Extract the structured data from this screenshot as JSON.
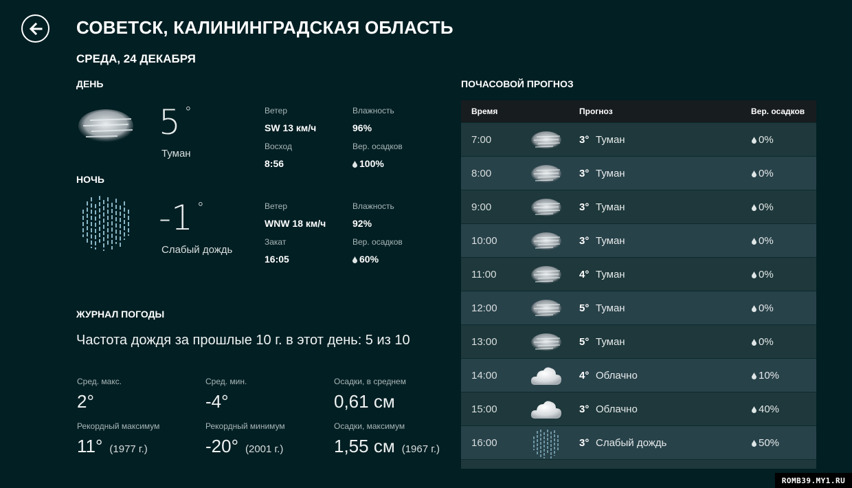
{
  "header": {
    "city": "СОВЕТСК, КАЛИНИНГРАДСКАЯ ОБЛАСТЬ",
    "date": "СРЕДА, 24 ДЕКАБРЯ",
    "back_icon": "back-arrow-icon"
  },
  "day": {
    "label": "ДЕНЬ",
    "icon": "fog-icon",
    "temp": "5",
    "deg": "°",
    "condition": "Туман",
    "wind_label": "Ветер",
    "wind": "SW 13 км/ч",
    "humidity_label": "Влажность",
    "humidity": "96%",
    "sun_label": "Восход",
    "sun": "8:56",
    "precip_label": "Вер. осадков",
    "precip": "100%"
  },
  "night": {
    "label": "НОЧЬ",
    "icon": "light-rain-icon",
    "temp": "-1",
    "deg": "°",
    "condition": "Слабый дождь",
    "wind_label": "Ветер",
    "wind": "WNW 18 км/ч",
    "humidity_label": "Влажность",
    "humidity": "92%",
    "sun_label": "Закат",
    "sun": "16:05",
    "precip_label": "Вер. осадков",
    "precip": "60%"
  },
  "history": {
    "label": "ЖУРНАЛ ПОГОДЫ",
    "title": "Частота дождя за прошлые 10 г. в этот день: 5 из 10",
    "avg_max_label": "Сред. макс.",
    "avg_max": "2°",
    "avg_min_label": "Сред. мин.",
    "avg_min": "-4°",
    "avg_precip_label": "Осадки, в среднем",
    "avg_precip": "0,61 см",
    "rec_max_label": "Рекордный максимум",
    "rec_max": "11°",
    "rec_max_year": "(1977 г.)",
    "rec_min_label": "Рекордный минимум",
    "rec_min": "-20°",
    "rec_min_year": "(2001 г.)",
    "max_precip_label": "Осадки, максимум",
    "max_precip": "1,55 см",
    "max_precip_year": "(1967 г.)"
  },
  "hourly": {
    "label": "ПОЧАСОВОЙ ПРОГНОЗ",
    "col_time": "Время",
    "col_forecast": "Прогноз",
    "col_precip": "Вер. осадков",
    "rows": [
      {
        "time": "7:00",
        "icon": "fog-icon",
        "temp": "3°",
        "cond": "Туман",
        "precip": "0%"
      },
      {
        "time": "8:00",
        "icon": "fog-icon",
        "temp": "3°",
        "cond": "Туман",
        "precip": "0%"
      },
      {
        "time": "9:00",
        "icon": "fog-icon",
        "temp": "3°",
        "cond": "Туман",
        "precip": "0%"
      },
      {
        "time": "10:00",
        "icon": "fog-icon",
        "temp": "3°",
        "cond": "Туман",
        "precip": "0%"
      },
      {
        "time": "11:00",
        "icon": "fog-icon",
        "temp": "4°",
        "cond": "Туман",
        "precip": "0%"
      },
      {
        "time": "12:00",
        "icon": "fog-icon",
        "temp": "5°",
        "cond": "Туман",
        "precip": "0%"
      },
      {
        "time": "13:00",
        "icon": "fog-icon",
        "temp": "5°",
        "cond": "Туман",
        "precip": "0%"
      },
      {
        "time": "14:00",
        "icon": "cloud-icon",
        "temp": "4°",
        "cond": "Облачно",
        "precip": "10%"
      },
      {
        "time": "15:00",
        "icon": "cloud-icon",
        "temp": "3°",
        "cond": "Облачно",
        "precip": "40%"
      },
      {
        "time": "16:00",
        "icon": "light-rain-icon",
        "temp": "3°",
        "cond": "Слабый дождь",
        "precip": "50%"
      }
    ]
  },
  "watermark": "ROMB39.MY1.RU",
  "colors": {
    "background": "#021f23",
    "row_odd": "#1e383b",
    "row_even": "#28424a",
    "header_row": "#171c1f",
    "label_gray": "#a9b6b7"
  }
}
